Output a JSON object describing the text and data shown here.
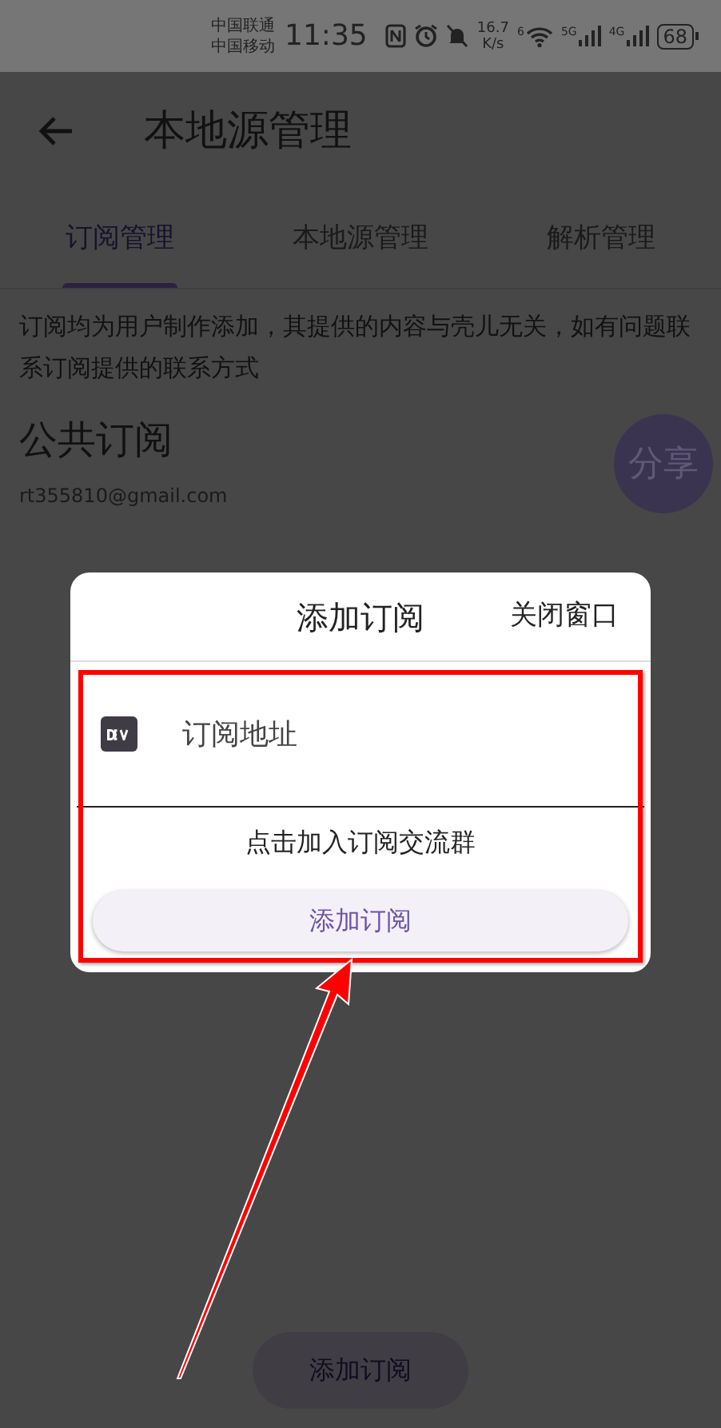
{
  "status_bar": {
    "carriers": [
      "中国联通",
      "中国移动"
    ],
    "time": "11:35",
    "speed": "16.7",
    "speed_unit": "K/s",
    "wifi_label": "6",
    "networks": [
      "5G",
      "4G"
    ],
    "battery": "68"
  },
  "app_bar": {
    "title": "本地源管理"
  },
  "tabs": [
    {
      "label": "订阅管理",
      "selected": true
    },
    {
      "label": "本地源管理",
      "selected": false
    },
    {
      "label": "解析管理",
      "selected": false
    }
  ],
  "notice": "订阅均为用户制作添加，其提供的内容与壳儿无关，如有问题联系订阅提供的联系方式",
  "public_subscription": {
    "title": "公共订阅",
    "email": "rt355810@gmail.com",
    "share_button": "分享"
  },
  "fab": "添加订阅",
  "dialog": {
    "title": "添加订阅",
    "close": "关闭窗口",
    "field": {
      "placeholder": "订阅地址"
    },
    "join_link": "点击加入订阅交流群",
    "submit": "添加订阅"
  }
}
